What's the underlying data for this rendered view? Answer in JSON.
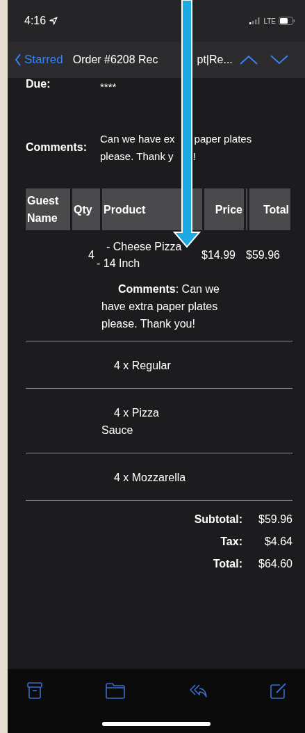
{
  "status_bar": {
    "time": "4:16",
    "network": "LTE"
  },
  "nav_bar": {
    "back": "Starred",
    "title_parts": [
      "Order #6208 Rec",
      "pt|Re..."
    ]
  },
  "fields": [
    {
      "label": "Due:",
      "value_parts": [
        [
          "****"
        ]
      ]
    },
    {
      "label": "Comments:",
      "value_parts": [
        [
          "Can we have ex",
          "paper plates"
        ],
        [
          "please. Thank y",
          "!"
        ]
      ]
    }
  ],
  "table": {
    "columns": [
      "Guest Name",
      "Qty",
      "Product",
      "Price",
      "",
      "Total"
    ],
    "rows": [
      {
        "guest": "",
        "qty": "4",
        "product": [
          "- Cheese Pizza",
          "- 14 Inch"
        ],
        "price": "$14.99",
        "total": "$59.96",
        "comment": "**Comments**:  Can we have extra paper plates please. Thank you!"
      }
    ]
  },
  "items": [
    "4 x  Regular",
    "4 x  Pizza Sauce",
    "4 x  Mozzarella"
  ],
  "totals": [
    {
      "label": "Subtotal:",
      "value": "$59.96"
    },
    {
      "label": "Tax:",
      "value": "$4.64"
    },
    {
      "label": "Total:",
      "value": "$64.60"
    }
  ]
}
